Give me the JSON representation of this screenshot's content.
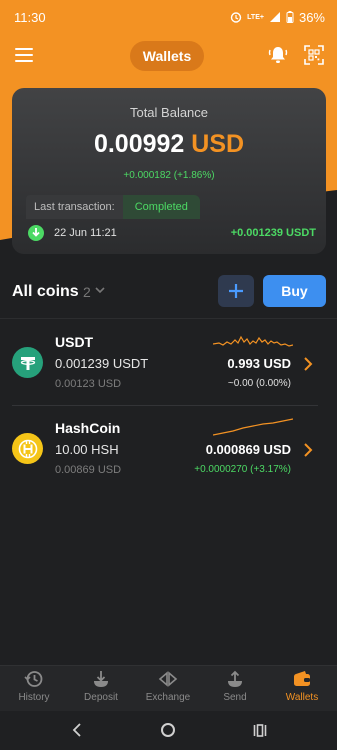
{
  "status_bar": {
    "time": "11:30",
    "network": "LTE+",
    "battery": "36%"
  },
  "header": {
    "title": "Wallets"
  },
  "balance_card": {
    "label": "Total Balance",
    "amount": "0.00992",
    "currency": "USD",
    "change": "+0.000182 (+1.86%)",
    "last_tx_label": "Last transaction:",
    "last_tx_status": "Completed",
    "last_tx_date": "22 Jun 11:21",
    "last_tx_amount": "+0.001239 USDT"
  },
  "coins_section": {
    "title": "All coins",
    "count": "2",
    "buy_label": "Buy"
  },
  "coins": [
    {
      "name": "USDT",
      "balance": "0.001239 USDT",
      "fiat": "0.00123 USD",
      "price": "0.993 USD",
      "change": "~0.00 (0.00%)",
      "logo": "tether-icon",
      "logo_color": "#26a17b",
      "change_color": "#e0e0e0"
    },
    {
      "name": "HashCoin",
      "balance": "10.00 HSH",
      "fiat": "0.00869 USD",
      "price": "0.000869 USD",
      "change": "+0.0000270 (+3.17%)",
      "logo": "hashcoin-icon",
      "logo_color": "#f5c518",
      "change_color": "#4cd964"
    }
  ],
  "bottom_nav": [
    {
      "label": "History",
      "icon": "history-icon"
    },
    {
      "label": "Deposit",
      "icon": "deposit-icon"
    },
    {
      "label": "Exchange",
      "icon": "exchange-icon"
    },
    {
      "label": "Send",
      "icon": "send-icon"
    },
    {
      "label": "Wallets",
      "icon": "wallet-icon",
      "active": true
    }
  ],
  "colors": {
    "accent": "#f39223",
    "positive": "#4cd964",
    "buy_button": "#3d8ff0",
    "background": "#1f2022"
  }
}
